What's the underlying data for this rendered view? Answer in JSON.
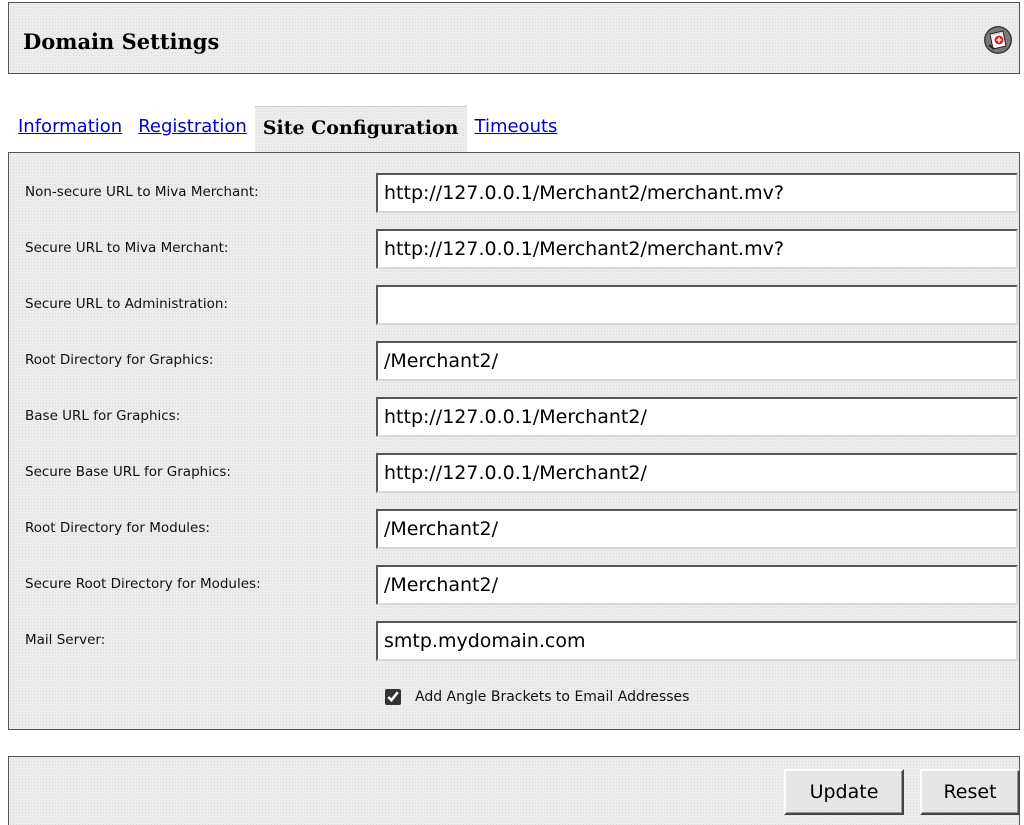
{
  "header": {
    "title": "Domain Settings",
    "help_icon": "help-book-icon"
  },
  "tabs": [
    {
      "label": "Information",
      "active": false
    },
    {
      "label": "Registration",
      "active": false
    },
    {
      "label": "Site Configuration",
      "active": true
    },
    {
      "label": "Timeouts",
      "active": false
    }
  ],
  "fields": [
    {
      "label": "Non-secure URL to Miva Merchant:",
      "value": "http://127.0.0.1/Merchant2/merchant.mv?"
    },
    {
      "label": "Secure URL to Miva Merchant:",
      "value": "http://127.0.0.1/Merchant2/merchant.mv?"
    },
    {
      "label": "Secure URL to Administration:",
      "value": ""
    },
    {
      "label": "Root Directory for Graphics:",
      "value": "/Merchant2/"
    },
    {
      "label": "Base URL for Graphics:",
      "value": "http://127.0.0.1/Merchant2/"
    },
    {
      "label": "Secure Base URL for Graphics:",
      "value": "http://127.0.0.1/Merchant2/"
    },
    {
      "label": "Root Directory for Modules:",
      "value": "/Merchant2/"
    },
    {
      "label": "Secure Root Directory for Modules:",
      "value": "/Merchant2/"
    },
    {
      "label": "Mail Server:",
      "value": "smtp.mydomain.com"
    }
  ],
  "checkbox": {
    "label": "Add Angle Brackets to Email Addresses",
    "checked": true
  },
  "actions": {
    "update_label": "Update",
    "reset_label": "Reset"
  }
}
